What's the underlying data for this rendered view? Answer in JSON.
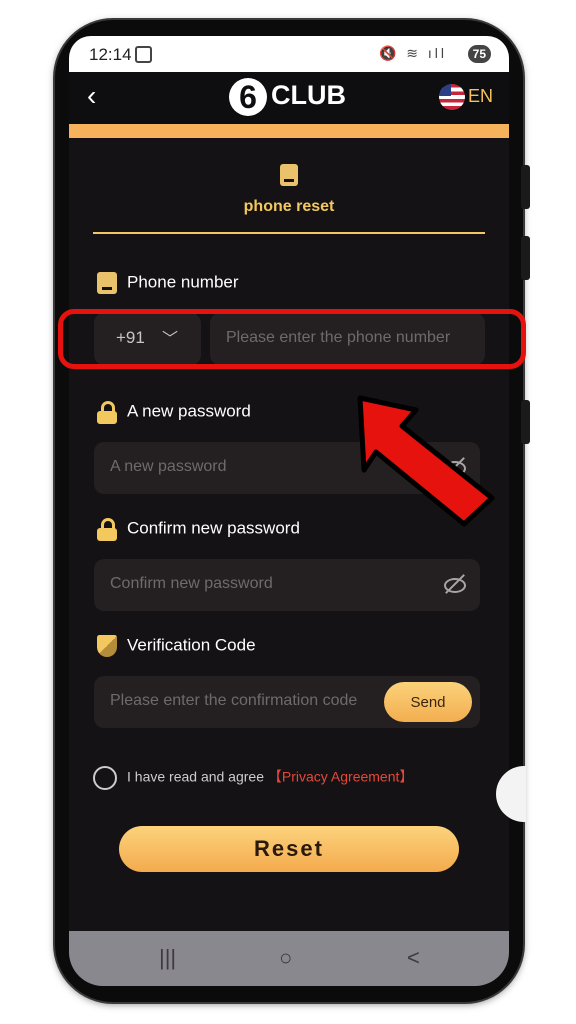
{
  "status_bar": {
    "time": "12:14",
    "icons": "🔇 ≋ ıll",
    "battery": "75"
  },
  "header": {
    "back_glyph": "‹",
    "logo_mark": "6",
    "logo_text": "CLUB",
    "language": "EN"
  },
  "tab": {
    "label": "phone reset"
  },
  "form": {
    "phone_label": "Phone number",
    "country_code": "+91",
    "phone_placeholder": "Please enter the phone number",
    "new_password_label": "A new password",
    "new_password_placeholder": "A new password",
    "confirm_password_label": "Confirm new password",
    "confirm_password_placeholder": "Confirm new password",
    "verification_label": "Verification Code",
    "verification_placeholder": "Please enter the confirmation code",
    "send_label": "Send",
    "agree_text": "I have read and agree",
    "privacy_link": "【Privacy Agreement】",
    "reset_label": "Reset"
  },
  "nav_bar": {
    "recents": "|||",
    "home": "○",
    "back": "<"
  },
  "colors": {
    "accent": "#f6b35c",
    "gold": "#f2c85f",
    "highlight": "#e5120d",
    "background": "#141214"
  }
}
